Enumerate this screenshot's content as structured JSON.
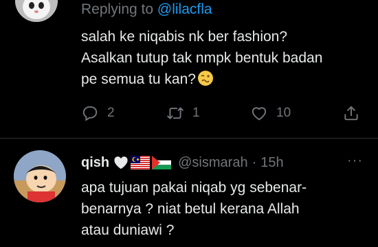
{
  "tweet1": {
    "reply_prefix": "Replying to ",
    "reply_handle": "@lilacfla",
    "lines": [
      "salah ke niqabis nk ber fashion?",
      "Asalkan tutup tak nmpk bentuk badan",
      "pe semua tu kan?"
    ],
    "emoji": "woozy-face-emoji",
    "stats": {
      "replies": "2",
      "retweets": "1",
      "likes": "10"
    }
  },
  "tweet2": {
    "display_name": "qish",
    "badges": [
      "heart-emoji",
      "malaysia-flag",
      "palestine-flag"
    ],
    "handle": "@sismarah",
    "separator": "·",
    "time": "15h",
    "more": "···",
    "lines": [
      "apa tujuan pakai niqab yg sebenar-",
      "benarnya ? niat betul kerana Allah",
      "atau duniawi ?"
    ]
  },
  "colors": {
    "background": "#000000",
    "text": "#e7e9ea",
    "muted": "#71767b",
    "link": "#1d9bf0",
    "divider": "#2f3336"
  },
  "icons": [
    "reply-icon",
    "retweet-icon",
    "like-icon",
    "share-icon",
    "more-icon"
  ]
}
